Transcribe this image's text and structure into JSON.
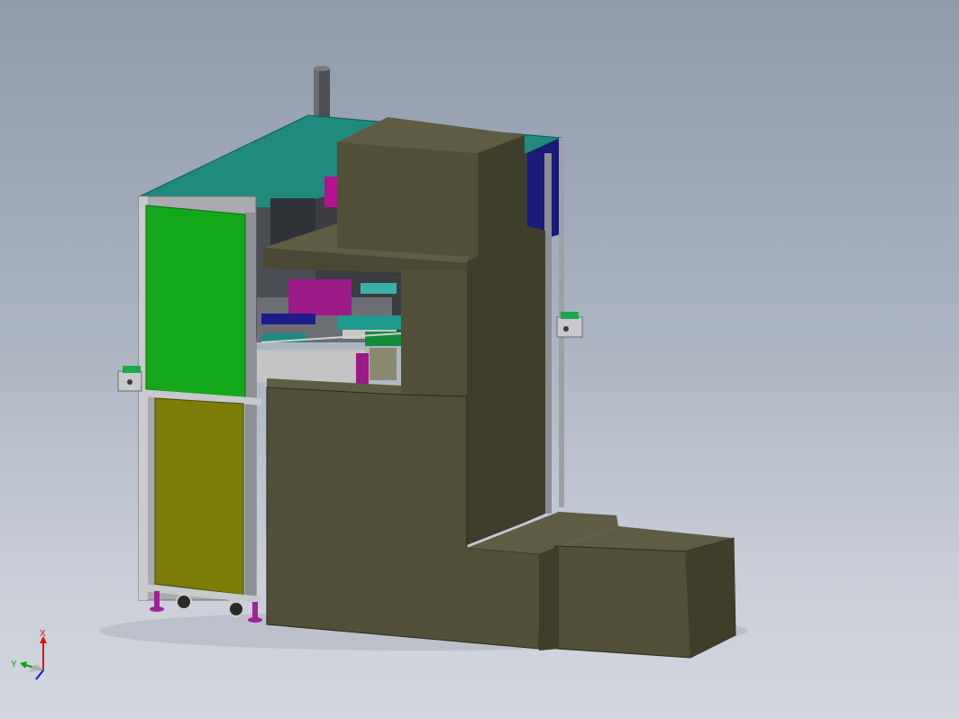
{
  "viewport": {
    "background_top": "#8f9aab",
    "background_bottom": "#d3d7df"
  },
  "model": {
    "colors": {
      "cabinet_top": "#1f8a7e",
      "green_panel": "#12a81a",
      "yellow_panel": "#7c7c07",
      "olive_guard": "#514f37",
      "olive_guard_light": "#5e5c43",
      "olive_guard_dark": "#3f3e2b",
      "frame": "#b8b8b8",
      "magenta_part": "#b2138f",
      "blue_part": "#1a1a78",
      "leg": "#a0209a"
    }
  },
  "triad": {
    "x_label": "X",
    "y_label": "Y",
    "x_color": "#e01010",
    "y_color": "#10a010",
    "z_color": "#1010e0"
  }
}
